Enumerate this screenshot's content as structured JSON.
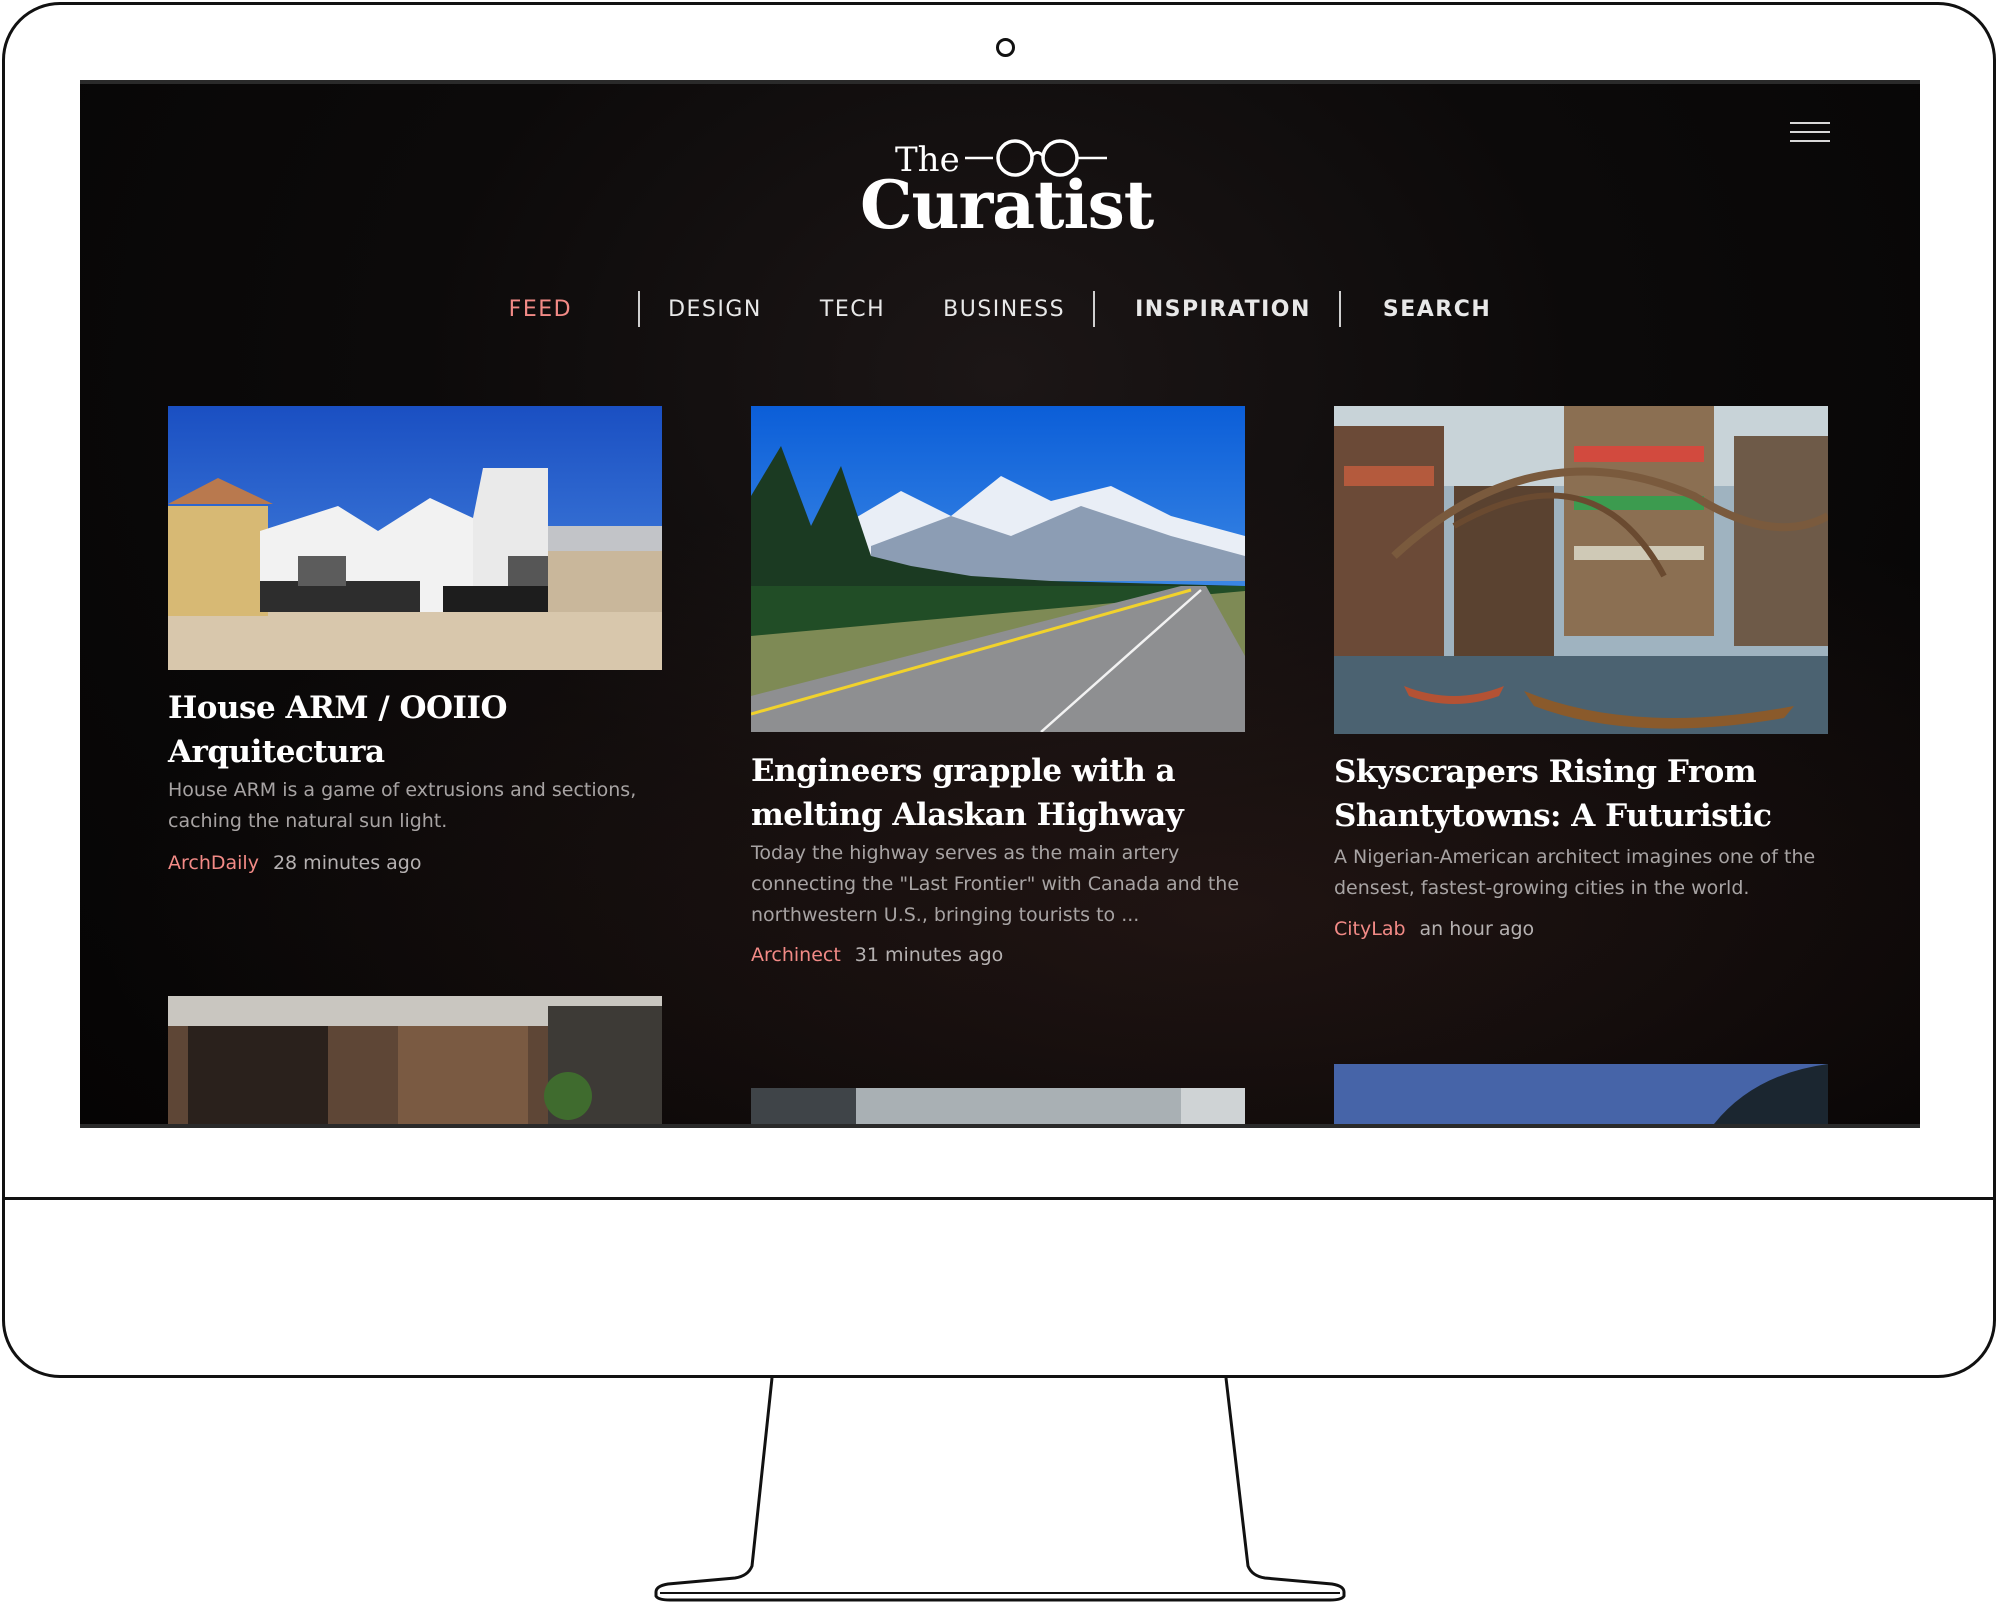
{
  "brand": {
    "the": "The",
    "name": "Curatist"
  },
  "nav": {
    "items": [
      {
        "label": "FEED"
      },
      {
        "label": "DESIGN"
      },
      {
        "label": "TECH"
      },
      {
        "label": "BUSINESS"
      },
      {
        "label": "INSPIRATION"
      },
      {
        "label": "SEARCH"
      }
    ]
  },
  "cards": [
    {
      "title": "House ARM / OOIIO Arquitectura",
      "description": "House ARM is a game of extrusions and sections, caching the natural sun light.",
      "source": "ArchDaily",
      "time": "28 minutes ago"
    },
    {
      "title": "Engineers grapple with a melting Alaskan Highway",
      "description": "Today the highway serves as the main artery connecting the \"Last Frontier\" with Canada and the northwestern U.S., bringing tourists to ...",
      "source": "Archinect",
      "time": "31 minutes ago"
    },
    {
      "title": "Skyscrapers Rising From Shantytowns: A Futuristic",
      "description": "A Nigerian-American architect imagines one of the densest, fastest-growing cities in the world.",
      "source": "CityLab",
      "time": "an hour ago"
    }
  ],
  "colors": {
    "accent": "#f28a86",
    "background": "#0c0a0a",
    "text": "#ffffff"
  }
}
